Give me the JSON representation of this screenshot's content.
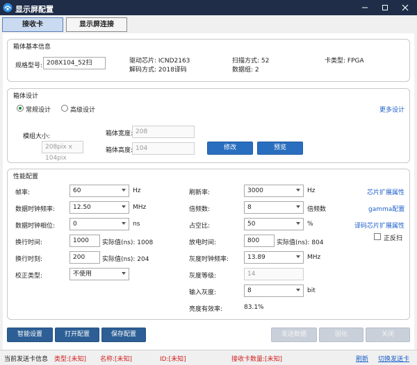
{
  "window": {
    "title": "显示屏配置"
  },
  "tabs": [
    {
      "label": "接收卡",
      "active": true
    },
    {
      "label": "显示屏连接",
      "active": false
    }
  ],
  "cabinet_info": {
    "title": "箱体基本信息",
    "spec_label": "规格型号:",
    "spec_value": "208X104_52扫",
    "driver_chip": "驱动芯片: ICND2163",
    "decode_method": "解码方式: 2018译码",
    "scan_mode": "扫描方式: 52",
    "data_groups": "数据组: 2",
    "card_type": "卡类型: FPGA"
  },
  "cabinet_design": {
    "title": "箱体设计",
    "radio_normal": "常规设计",
    "radio_advanced": "高级设计",
    "more_design": "更多设计",
    "module_size_label": "模组大小:",
    "module_size_value": "208pix x 104pix",
    "width_label": "箱体宽度:",
    "width_value": "208",
    "height_label": "箱体高度:",
    "height_value": "104",
    "modify_button": "修改",
    "preview_button": "预览"
  },
  "performance": {
    "title": "性能配置",
    "frame_rate_label": "帧率:",
    "frame_rate_value": "60",
    "frame_rate_unit": "Hz",
    "data_clock_label": "数据时钟频率:",
    "data_clock_value": "12.50",
    "data_clock_unit": "MHz",
    "data_phase_label": "数据时钟相位:",
    "data_phase_value": "0",
    "data_phase_unit": "ns",
    "line_time_label": "换行时间:",
    "line_time_value": "1000",
    "line_time_actual": "实际值(ns): 1008",
    "line_timing_label": "换行时刻:",
    "line_timing_value": "200",
    "line_timing_actual": "实际值(ns): 204",
    "correction_label": "校正类型:",
    "correction_value": "不使用",
    "refresh_label": "刷新率:",
    "refresh_value": "3000",
    "refresh_unit": "Hz",
    "multiplier_label": "倍频数:",
    "multiplier_value": "8",
    "multiplier_unit": "倍频数",
    "duty_label": "占空比:",
    "duty_value": "50",
    "duty_unit": "%",
    "discharge_label": "放电时间:",
    "discharge_value": "800",
    "discharge_actual": "实际值(ns): 804",
    "gray_clock_label": "灰度时钟频率:",
    "gray_clock_value": "13.89",
    "gray_clock_unit": "MHz",
    "gray_level_label": "灰度等级:",
    "gray_level_value": "14",
    "input_gray_label": "输入灰度:",
    "input_gray_value": "8",
    "input_gray_unit": "bit",
    "efficiency_label": "亮度有效率:",
    "efficiency_value": "83.1%",
    "chip_ext_link": "芯片扩展属性",
    "gamma_link": "gamma配置",
    "decoder_ext_link": "译码芯片扩展属性",
    "reverse_scan_label": "正反扫"
  },
  "bottom_buttons": {
    "smart": "智能设置",
    "open": "打开配置",
    "save": "保存配置",
    "send": "发送数据",
    "solidify": "固化",
    "close": "关闭"
  },
  "status": {
    "current_label": "当前发送卡信息",
    "type": "类型:[未知]",
    "name": "名称:[未知]",
    "id": "ID:[未知]",
    "count": "接收卡数量:[未知]",
    "refresh": "刷新",
    "switch": "切换发送卡"
  },
  "colors": {
    "titlebar": "#1f2d49",
    "accent_blue": "#2a6fbf",
    "link": "#1c5fc9",
    "status_red": "#d11f1f"
  }
}
